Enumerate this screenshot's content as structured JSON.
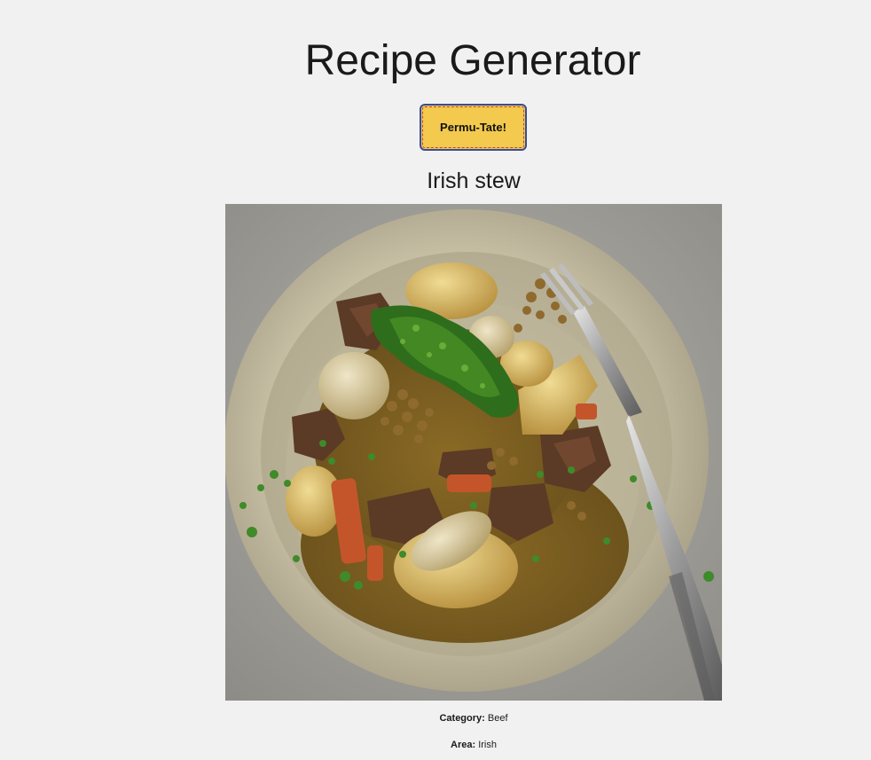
{
  "app": {
    "title": "Recipe Generator"
  },
  "controls": {
    "permutate_label": "Permu-Tate!"
  },
  "recipe": {
    "name": "Irish stew",
    "image_alt": "Irish stew",
    "category_label": "Category:",
    "category_value": "Beef",
    "area_label": "Area:",
    "area_value": "Irish"
  },
  "colors": {
    "background": "#f1f1f1",
    "button_fill": "#f3c94e",
    "button_border": "#3b4a9a"
  }
}
